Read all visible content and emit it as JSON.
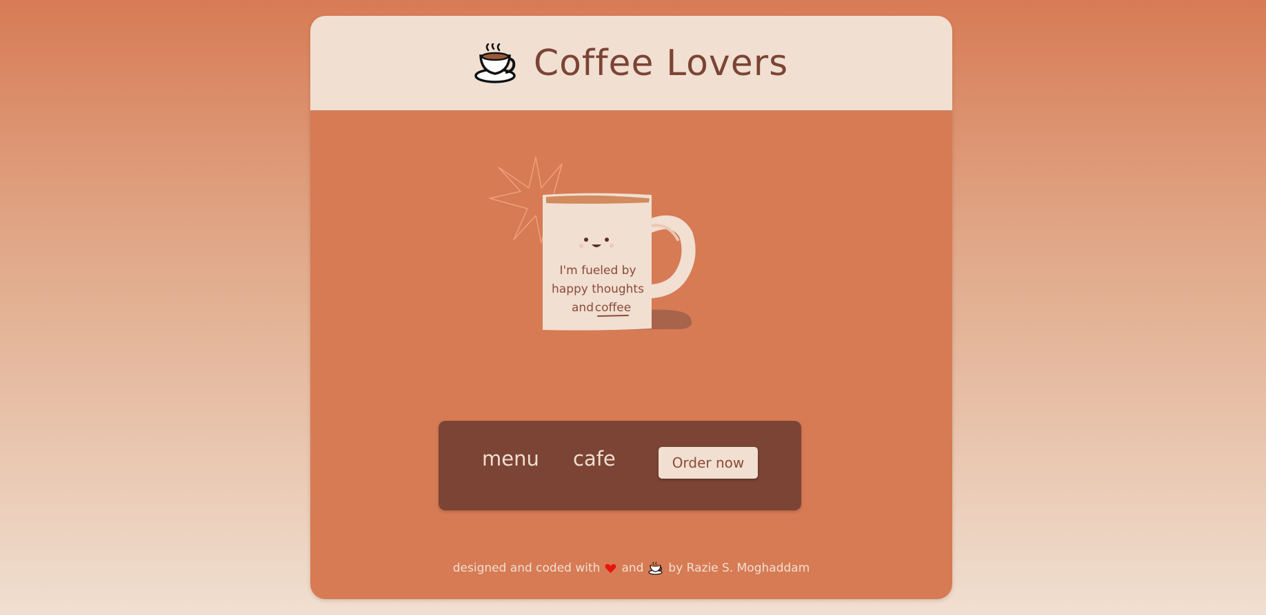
{
  "header": {
    "title": "Coffee Lovers",
    "logo_icon": "coffee-cup-icon"
  },
  "hero": {
    "mug_lines": [
      "I'm fueled by",
      "happy thoughts",
      "and",
      "coffee"
    ],
    "illustration": "smiling-mug-illustration"
  },
  "nav": {
    "menu_label": "menu",
    "cafe_label": "cafe",
    "order_label": "Order now"
  },
  "footer": {
    "part1": "designed and coded with",
    "heart_icon": "heart-icon",
    "part2": "and",
    "cup_icon": "coffee-cup-icon",
    "part3": "by Razie S. Moghaddam"
  },
  "colors": {
    "accent": "#d77b55",
    "cream": "#f1dfd1",
    "brown": "#7b4435",
    "heart": "#e8150f"
  }
}
